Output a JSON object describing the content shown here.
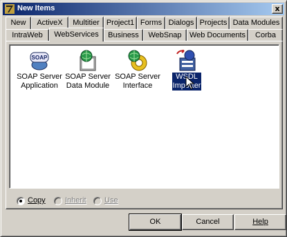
{
  "window": {
    "title": "New Items",
    "close_label": "x"
  },
  "tabs_back": [
    {
      "label": "New"
    },
    {
      "label": "ActiveX"
    },
    {
      "label": "Multitier"
    },
    {
      "label": "Project1"
    },
    {
      "label": "Forms"
    },
    {
      "label": "Dialogs"
    },
    {
      "label": "Projects"
    },
    {
      "label": "Data Modules"
    }
  ],
  "tabs_front": [
    {
      "label": "IntraWeb"
    },
    {
      "label": "WebServices",
      "active": true
    },
    {
      "label": "Business"
    },
    {
      "label": "WebSnap"
    },
    {
      "label": "Web Documents"
    },
    {
      "label": "Corba"
    }
  ],
  "items": [
    {
      "line1": "SOAP Server",
      "line2": "Application",
      "icon": "soap-icon"
    },
    {
      "line1": "SOAP Server",
      "line2": "Data Module",
      "icon": "data-module-icon"
    },
    {
      "line1": "SOAP Server",
      "line2": "Interface",
      "icon": "interface-icon"
    },
    {
      "line1": "WSDL",
      "line2": "Importer",
      "icon": "wsdl-importer-icon",
      "selected": true
    }
  ],
  "options": {
    "copy": "Copy",
    "inherit": "Inherit",
    "use": "Use",
    "selected": "copy"
  },
  "buttons": {
    "ok": "OK",
    "cancel": "Cancel",
    "help": "Help"
  },
  "colors": {
    "title_start": "#0a246a",
    "title_end": "#a6caf0",
    "selection": "#0a246a",
    "face": "#d4d0c8"
  }
}
